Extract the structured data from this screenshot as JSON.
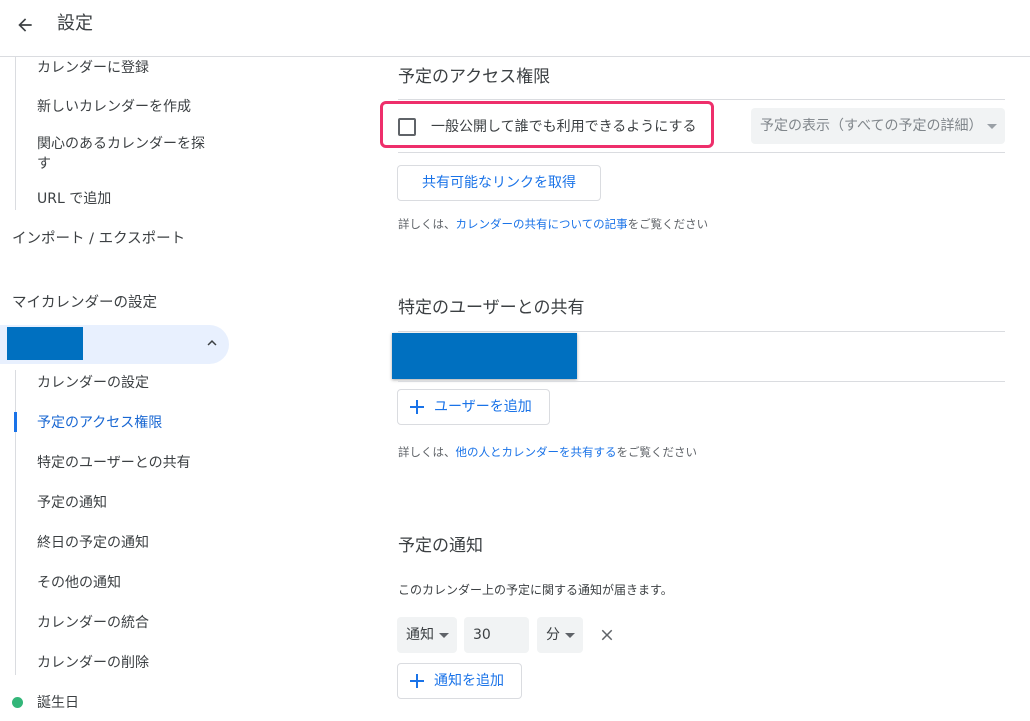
{
  "header": {
    "title": "設定"
  },
  "sidebar": {
    "items_top": [
      "カレンダーに登録",
      "新しいカレンダーを作成",
      "関心のあるカレンダーを探す",
      "URL で追加"
    ],
    "import_export": "インポート / エクスポート",
    "my_calendars_heading": "マイカレンダーの設定",
    "calendar_sub_items": [
      "カレンダーの設定",
      "予定のアクセス権限",
      "特定のユーザーとの共有",
      "予定の通知",
      "終日の予定の通知",
      "その他の通知",
      "カレンダーの統合",
      "カレンダーの削除"
    ],
    "birthday": "誕生日",
    "birthday_color": "#33b679"
  },
  "access": {
    "title": "予定のアクセス権限",
    "public_checkbox_label": "一般公開して誰でも利用できるようにする",
    "public_checked": false,
    "visibility_select": "予定の表示（すべての予定の詳細）",
    "share_link_button": "共有可能なリンクを取得",
    "help_prefix": "詳しくは、",
    "help_link": "カレンダーの共有についての記事",
    "help_suffix": "をご覧ください"
  },
  "sharing": {
    "title": "特定のユーザーとの共有",
    "add_user_button": "ユーザーを追加",
    "help_prefix": "詳しくは、",
    "help_link": "他の人とカレンダーを共有する",
    "help_suffix": "をご覧ください"
  },
  "notifications": {
    "title": "予定の通知",
    "description": "このカレンダー上の予定に関する通知が届きます。",
    "type": "通知",
    "amount": "30",
    "unit": "分",
    "add_button": "通知を追加"
  },
  "colors": {
    "accent": "#1a73e8",
    "highlight_border": "#ee2f6b",
    "redaction": "#0070c0"
  }
}
